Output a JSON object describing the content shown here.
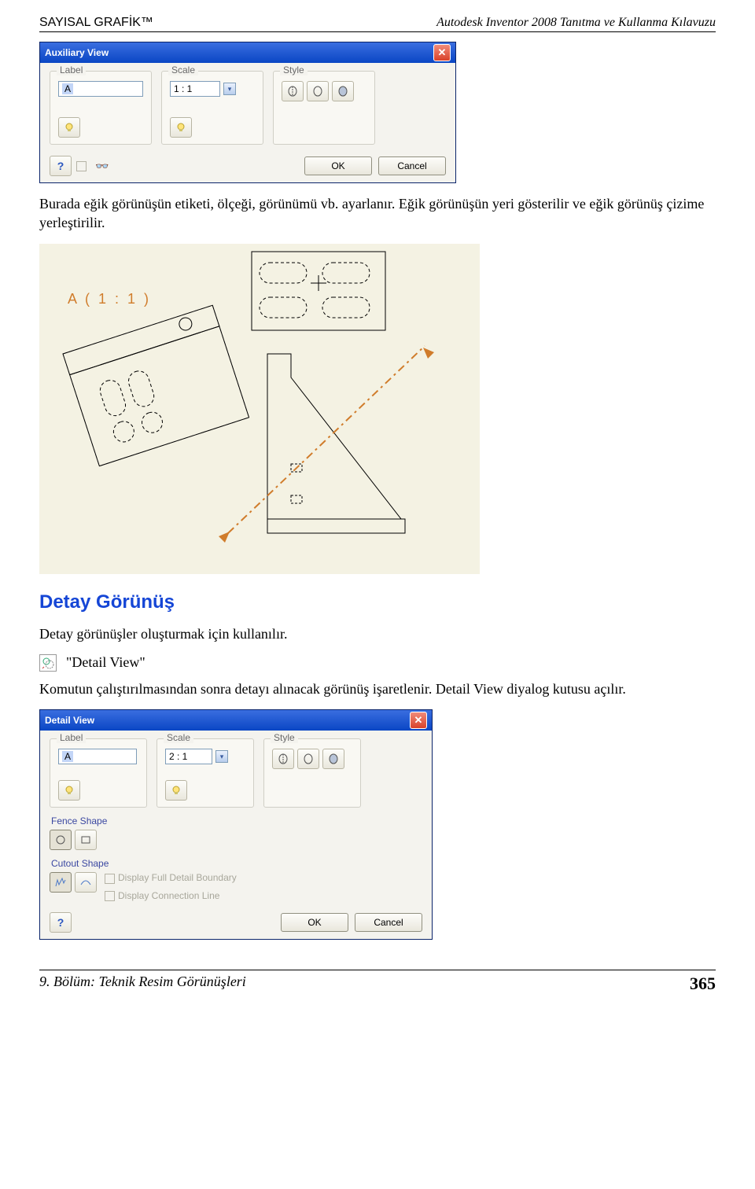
{
  "header": {
    "left": "SAYISAL GRAFİK™",
    "right": "Autodesk Inventor 2008 Tanıtma ve Kullanma Kılavuzu"
  },
  "dialog_aux": {
    "title": "Auxiliary View",
    "group_label": "Label",
    "group_scale": "Scale",
    "group_style": "Style",
    "label_value": "A",
    "scale_value": "1 : 1",
    "ok": "OK",
    "cancel": "Cancel"
  },
  "para1": "Burada eğik görünüşün etiketi, ölçeği, görünümü vb. ayarlanır. Eğik görünüşün yeri gösterilir ve eğik görünüş çizime yerleştirilir.",
  "illus_label": "A ( 1 : 1 )",
  "heading": "Detay Görünüş",
  "para2": "Detay görünüşler oluşturmak için kullanılır.",
  "cmd_name": "\"Detail View\"",
  "para3": "Komutun çalıştırılmasından sonra detayı alınacak görünüş işaretlenir. Detail View diyalog kutusu açılır.",
  "dialog_det": {
    "title": "Detail View",
    "group_label": "Label",
    "group_scale": "Scale",
    "group_style": "Style",
    "label_value": "A",
    "scale_value": "2 : 1",
    "fence": "Fence Shape",
    "cutout": "Cutout Shape",
    "chk1": "Display Full Detail Boundary",
    "chk2": "Display Connection Line",
    "ok": "OK",
    "cancel": "Cancel"
  },
  "footer": {
    "left": "9. Bölüm: Teknik Resim Görünüşleri",
    "right": "365"
  }
}
